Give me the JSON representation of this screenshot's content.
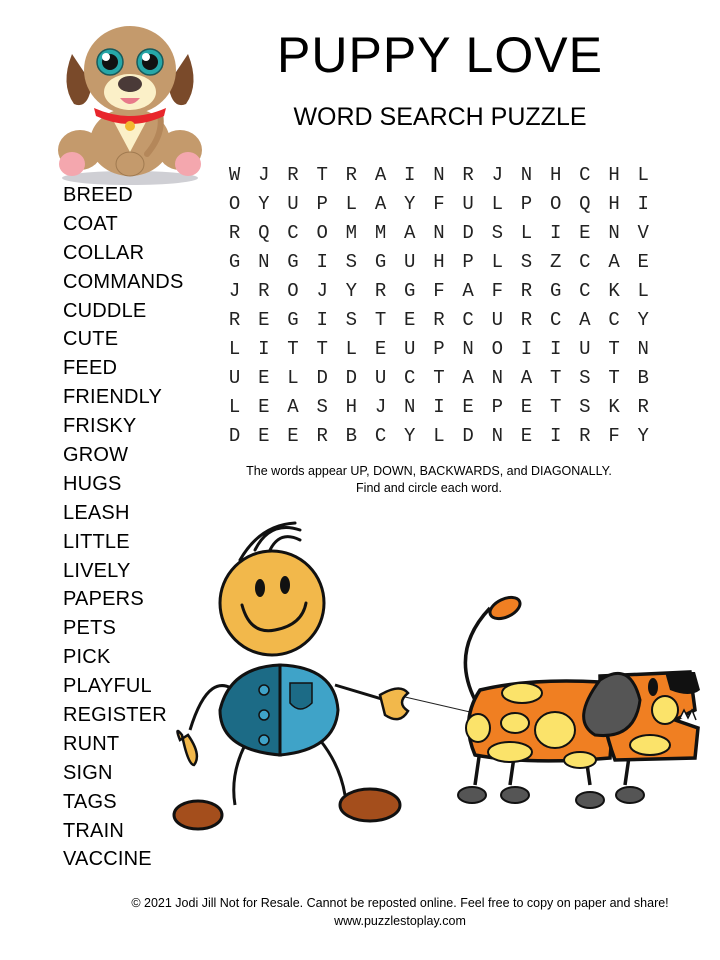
{
  "header": {
    "title": "PUPPY LOVE",
    "subtitle": "WORD SEARCH PUZZLE"
  },
  "word_list": [
    "BREED",
    "COAT",
    "COLLAR",
    "COMMANDS",
    "CUDDLE",
    "CUTE",
    "FEED",
    "FRIENDLY",
    "FRISKY",
    "GROW",
    "HUGS",
    "LEASH",
    "LITTLE",
    "LIVELY",
    "PAPERS",
    "PETS",
    "PICK",
    "PLAYFUL",
    "REGISTER",
    "RUNT",
    "SIGN",
    "TAGS",
    "TRAIN",
    "VACCINE"
  ],
  "grid": [
    [
      "W",
      "J",
      "R",
      "T",
      "R",
      "A",
      "I",
      "N",
      "R",
      "J",
      "N",
      "H",
      "C",
      "H",
      "L"
    ],
    [
      "O",
      "Y",
      "U",
      "P",
      "L",
      "A",
      "Y",
      "F",
      "U",
      "L",
      "P",
      "O",
      "Q",
      "H",
      "I"
    ],
    [
      "R",
      "Q",
      "C",
      "O",
      "M",
      "M",
      "A",
      "N",
      "D",
      "S",
      "L",
      "I",
      "E",
      "N",
      "V"
    ],
    [
      "G",
      "N",
      "G",
      "I",
      "S",
      "G",
      "U",
      "H",
      "P",
      "L",
      "S",
      "Z",
      "C",
      "A",
      "E"
    ],
    [
      "J",
      "R",
      "O",
      "J",
      "Y",
      "R",
      "G",
      "F",
      "A",
      "F",
      "R",
      "G",
      "C",
      "K",
      "L"
    ],
    [
      "R",
      "E",
      "G",
      "I",
      "S",
      "T",
      "E",
      "R",
      "C",
      "U",
      "R",
      "C",
      "A",
      "C",
      "Y"
    ],
    [
      "L",
      "I",
      "T",
      "T",
      "L",
      "E",
      "U",
      "P",
      "N",
      "O",
      "I",
      "I",
      "U",
      "T",
      "N"
    ],
    [
      "U",
      "E",
      "L",
      "D",
      "D",
      "U",
      "C",
      "T",
      "A",
      "N",
      "A",
      "T",
      "S",
      "T",
      "B"
    ],
    [
      "L",
      "E",
      "A",
      "S",
      "H",
      "J",
      "N",
      "I",
      "E",
      "P",
      "E",
      "T",
      "S",
      "K",
      "R"
    ],
    [
      "D",
      "E",
      "E",
      "R",
      "B",
      "C",
      "Y",
      "L",
      "D",
      "N",
      "E",
      "I",
      "R",
      "F",
      "Y"
    ]
  ],
  "instructions": {
    "line1": "The words appear UP, DOWN, BACKWARDS, and DIAGONALLY.",
    "line2": "Find and circle each word."
  },
  "footer": {
    "copyright": "© 2021  Jodi Jill Not for Resale. Cannot be reposted online. Feel free to copy on paper and share!",
    "website": "www.puzzlestoplay.com"
  },
  "illustrations": {
    "puppy": "sitting-puppy-illustration",
    "boy": "stick-figure-boy-illustration",
    "dog": "spotted-dog-on-leash-illustration"
  },
  "colors": {
    "puppy_fur": "#c49a6c",
    "puppy_ear": "#7a4a2a",
    "puppy_collar": "#e8262c",
    "puppy_eye": "#26a7a8",
    "boy_face": "#f2b84b",
    "boy_shirt_dark": "#1c6b86",
    "boy_shirt_light": "#3fa3c8",
    "boy_shoe": "#a44e1c",
    "dog_body": "#f07f22",
    "dog_spot": "#fbe36a",
    "dog_ear": "#555555"
  }
}
